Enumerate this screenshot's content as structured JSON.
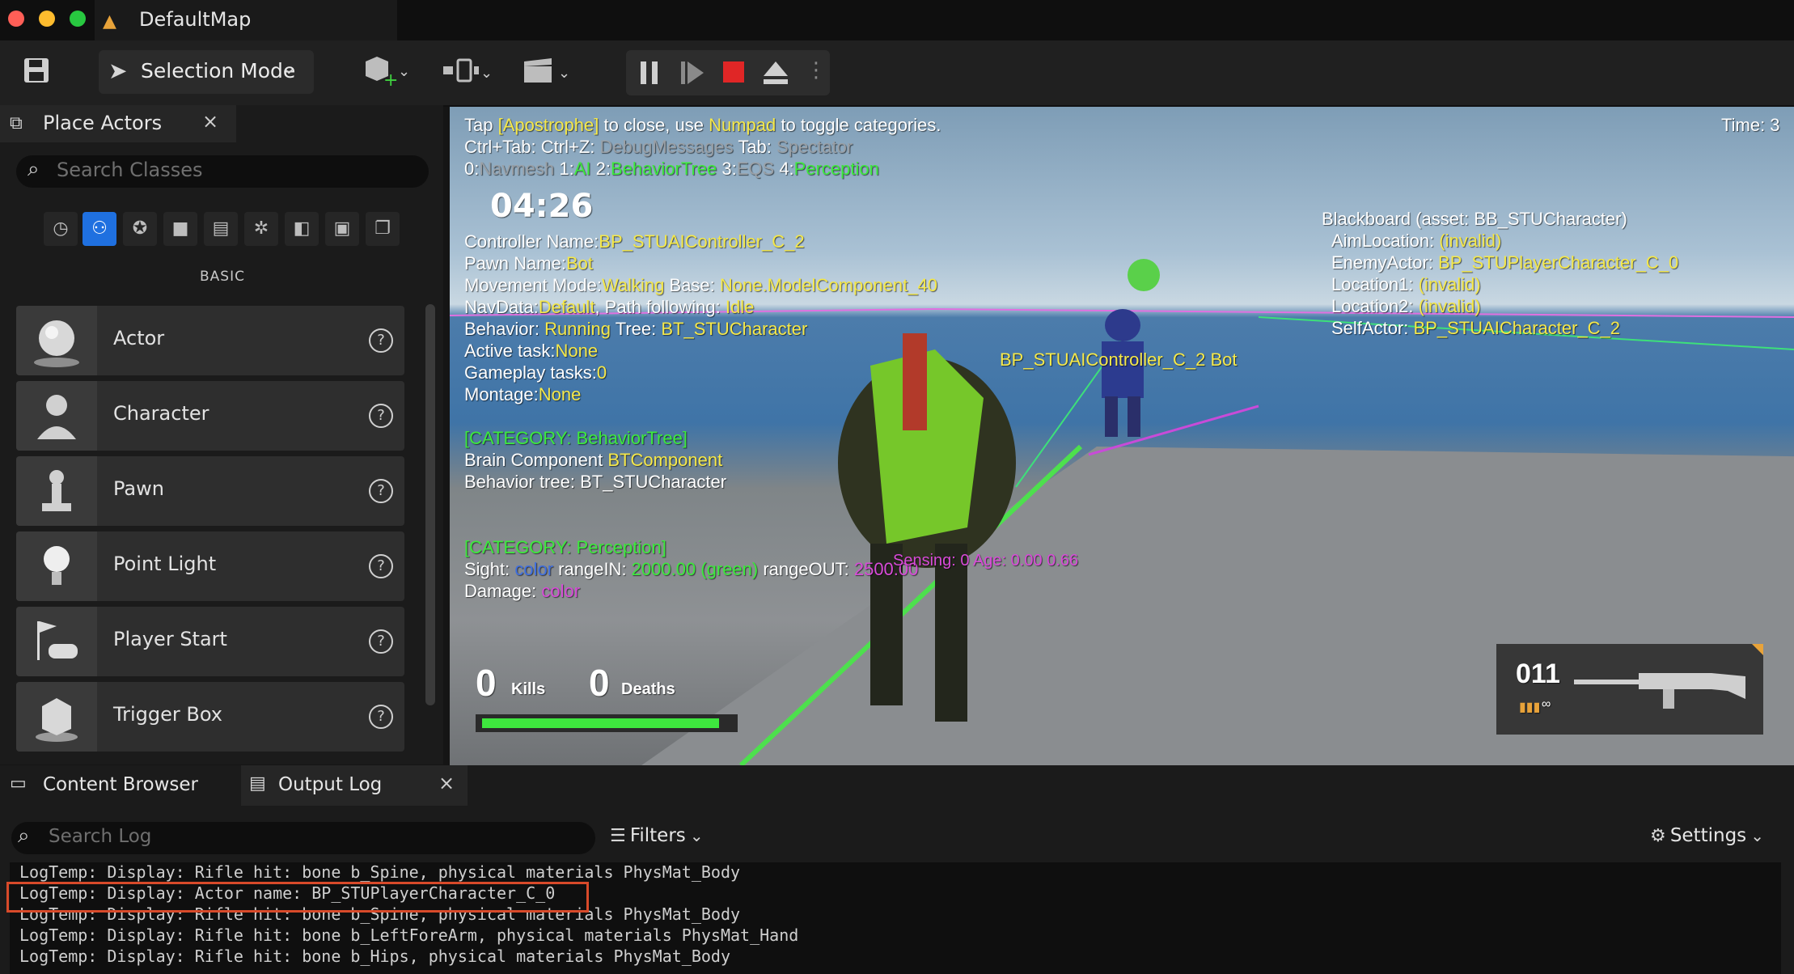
{
  "window": {
    "title": "DefaultMap"
  },
  "toolbar": {
    "selection_mode": "Selection Mode"
  },
  "place_actors": {
    "tab_label": "Place Actors",
    "search_placeholder": "Search Classes",
    "category_label": "BASIC",
    "items": [
      {
        "label": "Actor",
        "icon": "sphere-icon"
      },
      {
        "label": "Character",
        "icon": "character-icon"
      },
      {
        "label": "Pawn",
        "icon": "pawn-icon"
      },
      {
        "label": "Point Light",
        "icon": "light-bulb-icon"
      },
      {
        "label": "Player Start",
        "icon": "player-start-icon"
      },
      {
        "label": "Trigger Box",
        "icon": "trigger-box-icon"
      }
    ]
  },
  "viewport": {
    "line1": {
      "a": "Tap ",
      "b": "[Apostrophe]",
      "c": " to close, use ",
      "d": "Numpad",
      "e": " to toggle categories."
    },
    "time_label": "Time: 3",
    "line2": {
      "a": "Ctrl+Tab: ",
      "b": "Ctrl+Z: ",
      "c": "DebugMessages",
      "d": " Tab: ",
      "e": "Spectator"
    },
    "line3": {
      "a": "0:",
      "b": "Navmesh",
      "c": " 1:",
      "d": "AI",
      "e": " 2:",
      "f": "BehaviorTree",
      "g": " 3:",
      "h": "EQS",
      "i": " 4:",
      "j": "Perception"
    },
    "timer": "04:26",
    "controller": {
      "l1": "Controller Name:",
      "v1": "BP_STUAIController_C_2",
      "l2": "Pawn Name:",
      "v2": "Bot",
      "l3": "Movement Mode:",
      "v3": "Walking",
      "l3b": " Base: ",
      "v3b": "None.ModelComponent_40",
      "l4": "NavData:",
      "v4": "Default",
      "l4b": ", Path following: ",
      "v4b": "Idle",
      "l5": "Behavior: ",
      "v5": "Running",
      "l5b": " Tree: ",
      "v5b": "BT_STUCharacter",
      "l6": "Active task:",
      "v6": "None",
      "l7": "Gameplay tasks:",
      "v7": "0",
      "l8": "Montage:",
      "v8": "None"
    },
    "bt_category": "[CATEGORY: BehaviorTree]",
    "bt": {
      "l1": "Brain Component ",
      "v1": "BTComponent",
      "l2": "Behavior tree: BT_STUCharacter"
    },
    "perc_category": "[CATEGORY: Perception]",
    "perc": {
      "l1": "Sight: ",
      "v1": "color",
      "l1b": " rangeIN: ",
      "v1b": "2000.00 (green)",
      "l1c": " rangeOUT: ",
      "v1c": "2500.00",
      "overlay": "Sensing: 0 Age: 0.00 0.66",
      "l2": "Damage: ",
      "v2": "color"
    },
    "blackboard": {
      "title": "Blackboard (asset: BB_STUCharacter)",
      "rows": [
        {
          "k": "AimLocation: ",
          "v": "(invalid)"
        },
        {
          "k": "EnemyActor: ",
          "v": "BP_STUPlayerCharacter_C_0"
        },
        {
          "k": "Location1: ",
          "v": "(invalid)"
        },
        {
          "k": "Location2: ",
          "v": "(invalid)"
        },
        {
          "k": "SelfActor: ",
          "v": "BP_STUAICharacter_C_2"
        }
      ]
    },
    "bot_label": "BP_STUAIController_C_2 Bot",
    "kills_value": "0",
    "kills_label": "Kills",
    "deaths_value": "0",
    "deaths_label": "Deaths",
    "health_fraction": 0.95,
    "ammo": "011",
    "ammo_reserve": "∞"
  },
  "bottom": {
    "content_browser": "Content Browser",
    "output_log": "Output Log",
    "search_placeholder": "Search Log",
    "filters": "Filters",
    "settings": "Settings",
    "log_lines": [
      "LogTemp: Display: Rifle hit: bone b_Spine, physical materials PhysMat_Body",
      "LogTemp: Display: Actor name: BP_STUPlayerCharacter_C_0",
      "LogTemp: Display: Rifle hit: bone b_Spine, physical materials PhysMat_Body",
      "LogTemp: Display: Rifle hit: bone b_LeftForeArm, physical materials PhysMat_Hand",
      "LogTemp: Display: Rifle hit: bone b_Hips, physical materials PhysMat_Body"
    ]
  },
  "colors": {
    "accent": "#1f70e0",
    "highlight": "#d84a2a",
    "hud_yellow": "#f5e84a",
    "hud_green": "#3dea3d"
  }
}
